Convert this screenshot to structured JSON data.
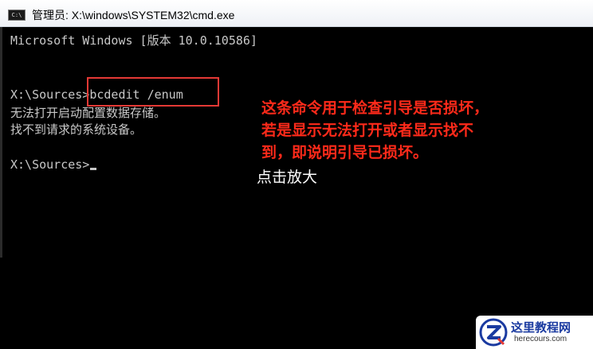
{
  "window": {
    "title": "管理员: X:\\windows\\SYSTEM32\\cmd.exe",
    "icon": "cmd-icon",
    "icon_text": "C:\\"
  },
  "console": {
    "lines": [
      "Microsoft Windows [版本 10.0.10586]",
      "",
      "",
      "X:\\Sources>bcdedit /enum",
      "无法打开启动配置数据存储。",
      "找不到请求的系统设备。",
      "",
      "X:\\Sources>"
    ],
    "text_color": "#c8c8c8",
    "background": "#000000"
  },
  "annotation": {
    "lines": [
      "这条命令用于检查引导是否损坏，",
      "若是显示无法打开或者显示找不",
      "到，即说明引导已损坏。"
    ],
    "color": "#ff2a1a",
    "highlight_color": "#e53935"
  },
  "zoom_label": "点击放大",
  "watermark": {
    "name": "这里教程网",
    "url": "herecours.com",
    "logo_icon": "z-logo-icon"
  }
}
